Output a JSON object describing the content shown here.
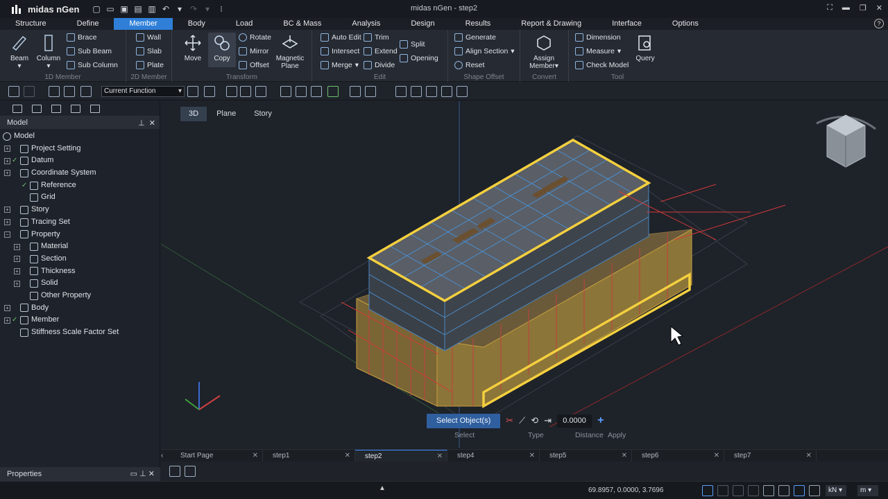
{
  "app": {
    "name": "midas nGen",
    "window_title": "midas nGen - step2"
  },
  "menu": [
    "Structure",
    "Define",
    "Member",
    "Body",
    "Load",
    "BC & Mass",
    "Analysis",
    "Design",
    "Results",
    "Report & Drawing",
    "Interface",
    "Options"
  ],
  "menu_active": "Member",
  "ribbon": {
    "member1d": {
      "label": "1D Member",
      "beam": "Beam",
      "column": "Column",
      "brace": "Brace",
      "sub_beam": "Sub Beam",
      "sub_column": "Sub Column"
    },
    "member2d": {
      "label": "2D Member",
      "wall": "Wall",
      "slab": "Slab",
      "plate": "Plate"
    },
    "transform": {
      "label": "Transform",
      "move": "Move",
      "copy": "Copy",
      "rotate": "Rotate",
      "mirror": "Mirror",
      "offset": "Offset",
      "magnetic1": "Magnetic",
      "magnetic2": "Plane"
    },
    "edit": {
      "label": "Edit",
      "auto_edit": "Auto Edit",
      "trim": "Trim",
      "intersect": "Intersect",
      "extend": "Extend",
      "split": "Split",
      "merge": "Merge",
      "divide": "Divide",
      "opening": "Opening"
    },
    "shape_offset": {
      "label": "Shape Offset",
      "generate": "Generate",
      "align_section": "Align Section",
      "reset": "Reset"
    },
    "convert": {
      "label": "Convert",
      "assign1": "Assign",
      "assign2": "Member"
    },
    "tool": {
      "label": "Tool",
      "dimension": "Dimension",
      "measure": "Measure",
      "check_model": "Check Model",
      "query": "Query"
    }
  },
  "toolbar": {
    "function_combo": "Current Function"
  },
  "panel": {
    "title": "Model",
    "tree": [
      {
        "label": "Model",
        "level": 0,
        "exp": "",
        "check": ""
      },
      {
        "label": "Project Setting",
        "level": 1,
        "exp": "+",
        "check": ""
      },
      {
        "label": "Datum",
        "level": 1,
        "exp": "+",
        "check": "✓"
      },
      {
        "label": "Coordinate System",
        "level": 1,
        "exp": "+",
        "check": ""
      },
      {
        "label": "Reference",
        "level": 2,
        "exp": "",
        "check": "✓"
      },
      {
        "label": "Grid",
        "level": 2,
        "exp": "",
        "check": ""
      },
      {
        "label": "Story",
        "level": 1,
        "exp": "+",
        "check": ""
      },
      {
        "label": "Tracing Set",
        "level": 1,
        "exp": "+",
        "check": ""
      },
      {
        "label": "Property",
        "level": 1,
        "exp": "−",
        "check": ""
      },
      {
        "label": "Material",
        "level": 2,
        "exp": "+",
        "check": ""
      },
      {
        "label": "Section",
        "level": 2,
        "exp": "+",
        "check": ""
      },
      {
        "label": "Thickness",
        "level": 2,
        "exp": "+",
        "check": ""
      },
      {
        "label": "Solid",
        "level": 2,
        "exp": "+",
        "check": ""
      },
      {
        "label": "Other Property",
        "level": 2,
        "exp": "",
        "check": ""
      },
      {
        "label": "Body",
        "level": 1,
        "exp": "+",
        "check": ""
      },
      {
        "label": "Member",
        "level": 1,
        "exp": "+",
        "check": "✓"
      },
      {
        "label": "Stiffness Scale Factor Set",
        "level": 1,
        "exp": "",
        "check": ""
      }
    ],
    "properties": "Properties"
  },
  "view": {
    "tabs": [
      "3D",
      "Plane",
      "Story"
    ],
    "select_button": "Select Object(s)",
    "distance_value": "0.0000",
    "labels": {
      "select": "Select",
      "type": "Type",
      "distance": "Distance",
      "apply": "Apply"
    }
  },
  "doc_tabs": [
    "Start Page",
    "step1",
    "step2",
    "step4",
    "step5",
    "step6",
    "step7"
  ],
  "doc_tab_active": "step2",
  "status": {
    "coords": "69.8957, 0.0000, 3.7696",
    "force_unit": "kN",
    "length_unit": "m"
  },
  "colors": {
    "accent": "#2f7fd8",
    "highlight": "#f4d03f",
    "grid_red": "#d23a3a"
  }
}
